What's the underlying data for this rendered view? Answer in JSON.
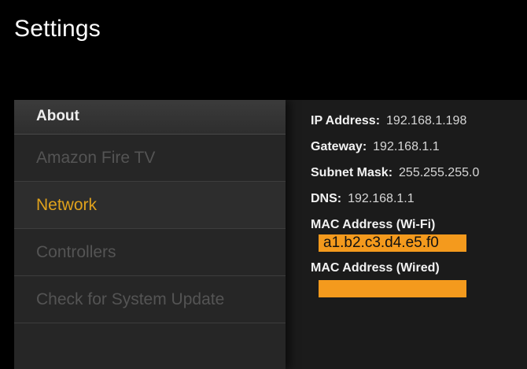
{
  "header": {
    "title": "Settings"
  },
  "menu": {
    "section_title": "About",
    "items": [
      {
        "label": "Amazon Fire TV"
      },
      {
        "label": "Network"
      },
      {
        "label": "Controllers"
      },
      {
        "label": "Check for System Update"
      }
    ],
    "active_item": "Network"
  },
  "network": {
    "ip_label": "IP Address:",
    "ip_value": "192.168.1.198",
    "gateway_label": "Gateway:",
    "gateway_value": "192.168.1.1",
    "subnet_label": "Subnet Mask:",
    "subnet_value": "255.255.255.0",
    "dns_label": "DNS:",
    "dns_value": "192.168.1.1",
    "mac_wifi_label": "MAC Address (Wi-Fi)",
    "mac_wifi_value": "a1.b2.c3.d4.e5.f0",
    "mac_wired_label": "MAC Address (Wired)",
    "mac_wired_value": ""
  },
  "colors": {
    "accent": "#e0a21c",
    "highlight": "#f49a1d",
    "background": "#000000",
    "panel": "#262626"
  }
}
